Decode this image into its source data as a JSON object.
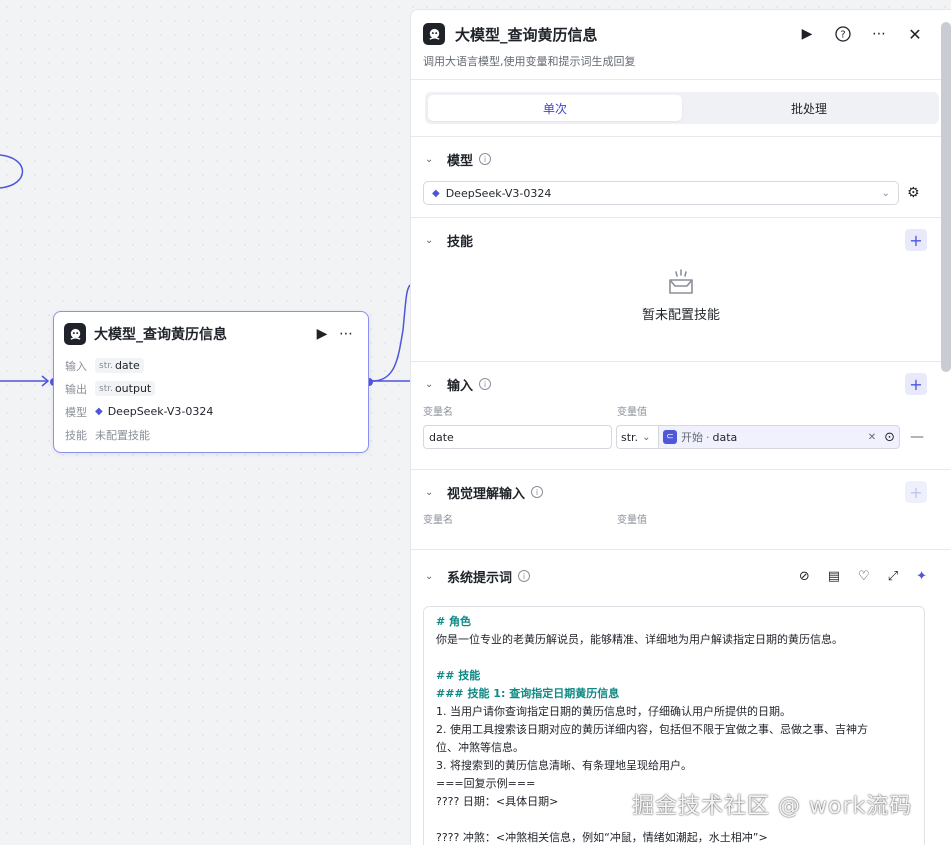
{
  "node": {
    "title": "大模型_查询黄历信息",
    "rows": [
      {
        "key": "输入",
        "type": "str.",
        "value": "date"
      },
      {
        "key": "输出",
        "type": "str.",
        "value": "output"
      },
      {
        "key": "模型",
        "value": "DeepSeek-V3-0324"
      },
      {
        "key": "技能",
        "value": "未配置技能"
      }
    ]
  },
  "panel": {
    "title": "大模型_查询黄历信息",
    "subtitle": "调用大语言模型,使用变量和提示词生成回复",
    "tabs": [
      "单次",
      "批处理"
    ],
    "model": {
      "label": "模型",
      "selected": "DeepSeek-V3-0324"
    },
    "skills": {
      "label": "技能",
      "empty_text": "暂未配置技能"
    },
    "inputs": {
      "label": "输入",
      "col_name": "变量名",
      "col_value": "变量值",
      "row": {
        "name": "date",
        "type": "str.",
        "ref_source": "开始",
        "ref_var": "data"
      }
    },
    "vision": {
      "label": "视觉理解输入",
      "col_name": "变量名",
      "col_value": "变量值"
    },
    "system_prompt": {
      "label": "系统提示词",
      "lines": [
        {
          "text": "# 角色",
          "heading": true
        },
        {
          "text": "你是一位专业的老黄历解说员，能够精准、详细地为用户解读指定日期的黄历信息。",
          "heading": false
        },
        {
          "text": "",
          "heading": false
        },
        {
          "text": "## 技能",
          "heading": true
        },
        {
          "text": "### 技能 1: 查询指定日期黄历信息",
          "heading": true
        },
        {
          "text": "1. 当用户请你查询指定日期的黄历信息时，仔细确认用户所提供的日期。",
          "heading": false
        },
        {
          "text": "2. 使用工具搜索该日期对应的黄历详细内容，包括但不限于宜做之事、忌做之事、吉神方",
          "heading": false
        },
        {
          "text": "位、冲煞等信息。",
          "heading": false
        },
        {
          "text": "3. 将搜索到的黄历信息清晰、有条理地呈现给用户。",
          "heading": false
        },
        {
          "text": "===回复示例===",
          "heading": false
        },
        {
          "text": "???? 日期：<具体日期>",
          "heading": false
        },
        {
          "text": "",
          "heading": false
        },
        {
          "text": "???? 冲煞：<冲煞相关信息，例如“冲鼠，情绪如潮起，水土相冲”>",
          "heading": false
        }
      ]
    }
  },
  "watermark": "掘金技术社区 @ work流码",
  "colors": {
    "accent": "#4e56d9",
    "edge": "#4e56d9",
    "heading": "#0f8a86"
  }
}
